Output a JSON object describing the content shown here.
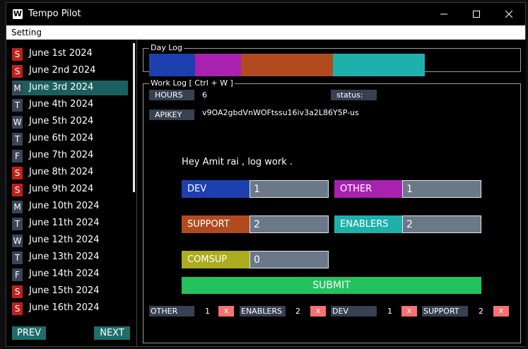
{
  "window": {
    "title": "Tempo Pilot",
    "icon_letter": "W"
  },
  "menu": {
    "items": [
      "Setting"
    ]
  },
  "sidebar": {
    "days": [
      {
        "badge": "S",
        "label": "June 1st 2024",
        "weekend": true
      },
      {
        "badge": "S",
        "label": "June 2nd 2024",
        "weekend": true
      },
      {
        "badge": "M",
        "label": "June 3rd 2024",
        "weekend": false,
        "selected": true
      },
      {
        "badge": "T",
        "label": "June 4th 2024",
        "weekend": false
      },
      {
        "badge": "W",
        "label": "June 5th 2024",
        "weekend": false
      },
      {
        "badge": "T",
        "label": "June 6th 2024",
        "weekend": false
      },
      {
        "badge": "F",
        "label": "June 7th 2024",
        "weekend": false
      },
      {
        "badge": "S",
        "label": "June 8th 2024",
        "weekend": true
      },
      {
        "badge": "S",
        "label": "June 9th 2024",
        "weekend": true
      },
      {
        "badge": "M",
        "label": "June 10th 2024",
        "weekend": false
      },
      {
        "badge": "T",
        "label": "June 11th 2024",
        "weekend": false
      },
      {
        "badge": "W",
        "label": "June 12th 2024",
        "weekend": false
      },
      {
        "badge": "T",
        "label": "June 13th 2024",
        "weekend": false
      },
      {
        "badge": "F",
        "label": "June 14th 2024",
        "weekend": false
      },
      {
        "badge": "S",
        "label": "June 15th 2024",
        "weekend": true
      },
      {
        "badge": "S",
        "label": "June 16th 2024",
        "weekend": true
      }
    ],
    "prev_label": "PREV",
    "next_label": "NEXT"
  },
  "day_log": {
    "legend": "Day Log",
    "segments": [
      {
        "name": "DEV",
        "hours": 1,
        "color": "#1e40af"
      },
      {
        "name": "OTHER",
        "hours": 1,
        "color": "#a821b0"
      },
      {
        "name": "SUPPORT",
        "hours": 2,
        "color": "#b14b1f"
      },
      {
        "name": "ENABLERS",
        "hours": 2,
        "color": "#1eb0ab"
      }
    ],
    "total_hours": 6
  },
  "work_log": {
    "legend": "Work Log [ Ctrl + W ]",
    "hours_label": "HOURS",
    "hours_value": "6",
    "status_label": "status:",
    "apikey_label": "APIKEY",
    "apikey_value": "v9OA2gbdVnWOFtssu16iv3a2L86Y5P-us",
    "greeting": "Hey Amit rai , log work .",
    "categories": {
      "dev": {
        "label": "DEV",
        "value": "1",
        "color": "#1e40af"
      },
      "other": {
        "label": "OTHER",
        "value": "1",
        "color": "#a821b0"
      },
      "support": {
        "label": "SUPPORT",
        "value": "2",
        "color": "#b14b1f"
      },
      "enablers": {
        "label": "ENABLERS",
        "value": "2",
        "color": "#1eb0ab"
      },
      "comsup": {
        "label": "COMSUP",
        "value": "0",
        "color": "#a9ad1e"
      }
    },
    "submit_label": "SUBMIT",
    "chips": [
      {
        "label": "OTHER",
        "count": "1"
      },
      {
        "label": "ENABLERS",
        "count": "2"
      },
      {
        "label": "DEV",
        "count": "1"
      },
      {
        "label": "SUPPORT",
        "count": "2"
      }
    ],
    "remove_label": "x"
  }
}
